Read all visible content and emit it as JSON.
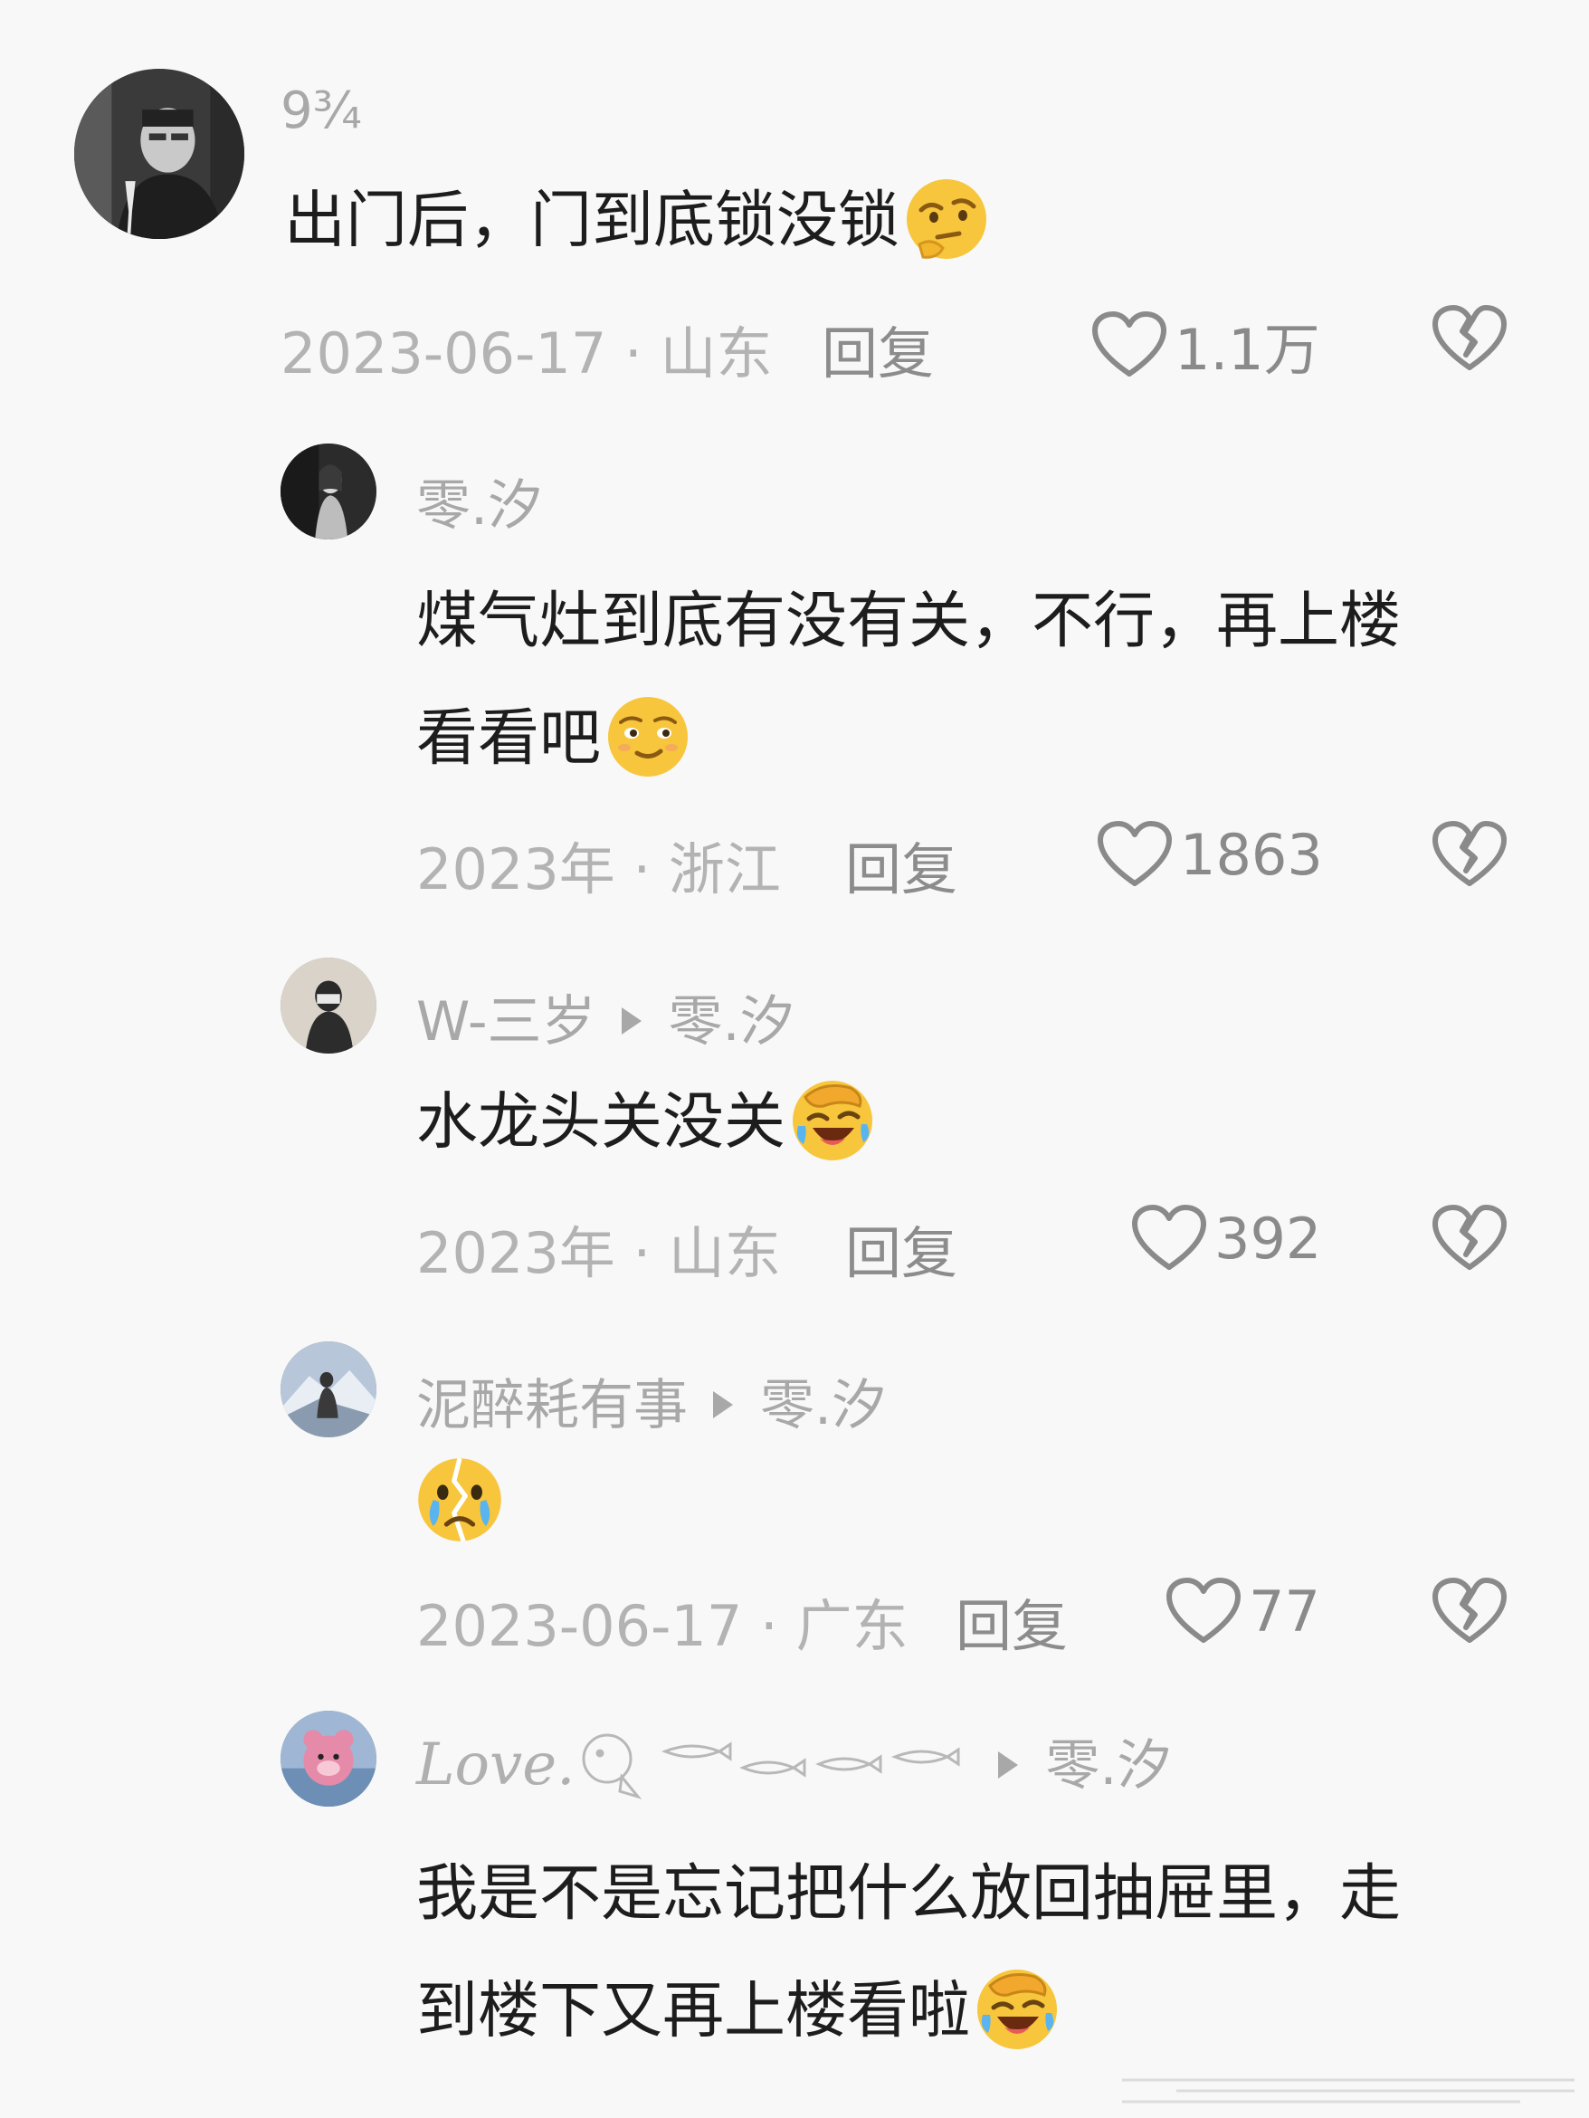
{
  "comments": [
    {
      "user": "9¾",
      "text": "出门后，门到底锁没锁",
      "emoji": "thinking-face",
      "meta": "2023-06-17 · 山东",
      "reply": "回复",
      "likes": "1.1万"
    },
    {
      "user": "零.汐",
      "text_line1": "煤气灶到底有没有关，不行，再上楼",
      "text_line2": "看看吧",
      "emoji": "smirk-face",
      "meta": "2023年 · 浙江",
      "reply": "回复",
      "likes": "1863"
    },
    {
      "user": "W-三岁",
      "reply_to": "零.汐",
      "text": "水龙头关没关",
      "emoji": "facepalm-laugh",
      "meta": "2023年 · 山东",
      "reply": "回复",
      "likes": "392"
    },
    {
      "user": "泥醉耗有事",
      "reply_to": "零.汐",
      "text": "",
      "emoji": "broken-crying-face",
      "meta": "2023-06-17 · 广东",
      "reply": "回复",
      "likes": "77"
    },
    {
      "user": "Love.",
      "reply_to": "零.汐",
      "text_line1": "我是不是忘记把什么放回抽屉里，走",
      "text_line2": "到楼下又再上楼看啦",
      "emoji": "facepalm-laugh",
      "meta": "",
      "reply": "",
      "likes": ""
    }
  ],
  "colors": {
    "background": "#f8f8f8",
    "username": "#a8a8a8",
    "meta": "#b3b3b3",
    "icon": "#8a8a8a"
  }
}
